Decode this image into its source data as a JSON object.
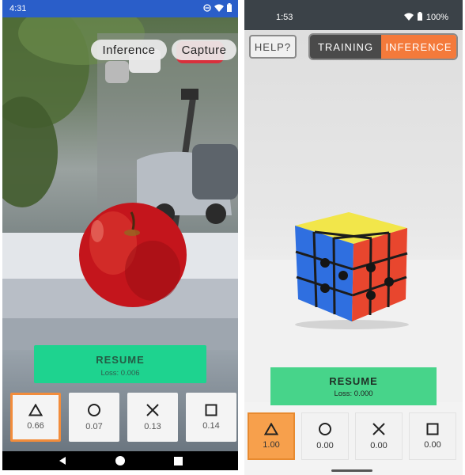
{
  "left_phone": {
    "status_bar": {
      "time": "4:31",
      "icons": [
        "dnd-icon",
        "wifi-icon",
        "battery-icon"
      ]
    },
    "top_buttons": {
      "inference_label": "Inference",
      "capture_label": "Capture"
    },
    "resume": {
      "label": "RESUME",
      "loss": "Loss: 0.006"
    },
    "classes": [
      {
        "icon": "triangle-icon",
        "value": "0.66",
        "selected": true
      },
      {
        "icon": "circle-icon",
        "value": "0.07",
        "selected": false
      },
      {
        "icon": "x-icon",
        "value": "0.13",
        "selected": false
      },
      {
        "icon": "square-icon",
        "value": "0.14",
        "selected": false
      }
    ],
    "nav_bar": [
      "back-icon",
      "home-icon",
      "recents-icon"
    ]
  },
  "right_phone": {
    "status_bar": {
      "time": "1:53",
      "battery": "100%",
      "icons": [
        "wifi-icon",
        "battery-icon"
      ]
    },
    "help_label": "HELP?",
    "mode_tabs": {
      "training_label": "TRAINING",
      "inference_label": "INFERENCE",
      "active": "INFERENCE"
    },
    "resume": {
      "label": "RESUME",
      "loss": "Loss: 0.000"
    },
    "classes": [
      {
        "icon": "triangle-icon",
        "value": "1.00",
        "selected": true
      },
      {
        "icon": "circle-icon",
        "value": "0.00",
        "selected": false
      },
      {
        "icon": "x-icon",
        "value": "0.00",
        "selected": false
      },
      {
        "icon": "square-icon",
        "value": "0.00",
        "selected": false
      }
    ]
  },
  "colors": {
    "left_status_bar": "#2a5ec9",
    "resume_left": "#1ed38f",
    "resume_right": "#47d48a",
    "selected_outline": "#f28c3b",
    "inference_tab": "#f47a3b",
    "training_tab": "#4a4a4a",
    "selected_fill_right": "#f7a04c"
  }
}
